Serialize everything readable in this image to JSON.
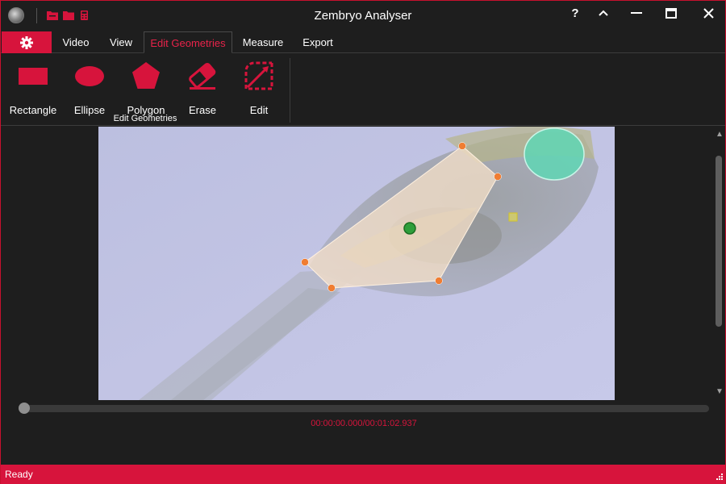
{
  "app": {
    "title": "Zembryo Analyser"
  },
  "titlebar": {
    "quick_access_icons": [
      "open-folder-icon",
      "folder-icon",
      "calculator-icon"
    ],
    "window_buttons": [
      "help-icon",
      "collapse-ribbon-icon",
      "minimize-icon",
      "maximize-icon",
      "close-icon"
    ],
    "help_label": "?"
  },
  "tabs": [
    {
      "label": "Video",
      "active": false
    },
    {
      "label": "View",
      "active": false
    },
    {
      "label": "Edit Geometries",
      "active": true
    },
    {
      "label": "Measure",
      "active": false
    },
    {
      "label": "Export",
      "active": false
    }
  ],
  "settings_tab": {
    "icon": "gear-icon"
  },
  "ribbon": {
    "group_label": "Edit Geometries",
    "buttons": [
      {
        "label": "Rectangle",
        "icon": "rectangle-icon"
      },
      {
        "label": "Ellipse",
        "icon": "ellipse-icon"
      },
      {
        "label": "Polygon",
        "icon": "polygon-icon"
      },
      {
        "label": "Erase",
        "icon": "eraser-icon"
      },
      {
        "label": "Edit",
        "icon": "edit-shape-icon"
      }
    ]
  },
  "viewer": {
    "content": "zebrafish embryo micrograph with polygon and ellipse annotations"
  },
  "timeline": {
    "position_fraction": 0.0,
    "time_text": "00:00:00.000/00:01:02.937"
  },
  "status": {
    "text": "Ready"
  },
  "colors": {
    "accent": "#d7143c",
    "background": "#1e1e1e",
    "polygon_fill": "#f5e0c8",
    "vertex": "#f07d32",
    "centroid": "#2e9e3a",
    "ellipse_fill": "#5fd6b4"
  }
}
